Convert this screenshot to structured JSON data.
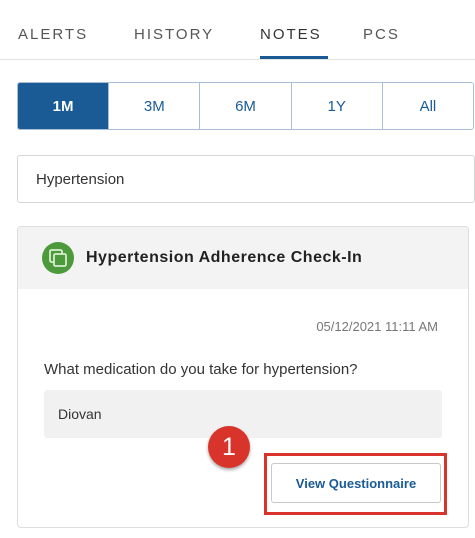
{
  "tabs": [
    "ALERTS",
    "HISTORY",
    "NOTES",
    "PCS"
  ],
  "active_tab": "NOTES",
  "time_range": {
    "options": [
      "1M",
      "3M",
      "6M",
      "1Y",
      "All"
    ],
    "selected": "1M"
  },
  "filter": {
    "value": "Hypertension"
  },
  "note_card": {
    "title": "Hypertension Adherence Check-In",
    "icon": "questionnaire-icon",
    "timestamp": "05/12/2021 11:11 AM",
    "question": "What medication do you take for hypertension?",
    "answer": "Diovan",
    "button_label": "View Questionnaire"
  },
  "callout": {
    "step_number": "1"
  },
  "colors": {
    "accent": "#1a5b96",
    "icon_green": "#4d9a3c",
    "callout_red": "#d9342b"
  }
}
